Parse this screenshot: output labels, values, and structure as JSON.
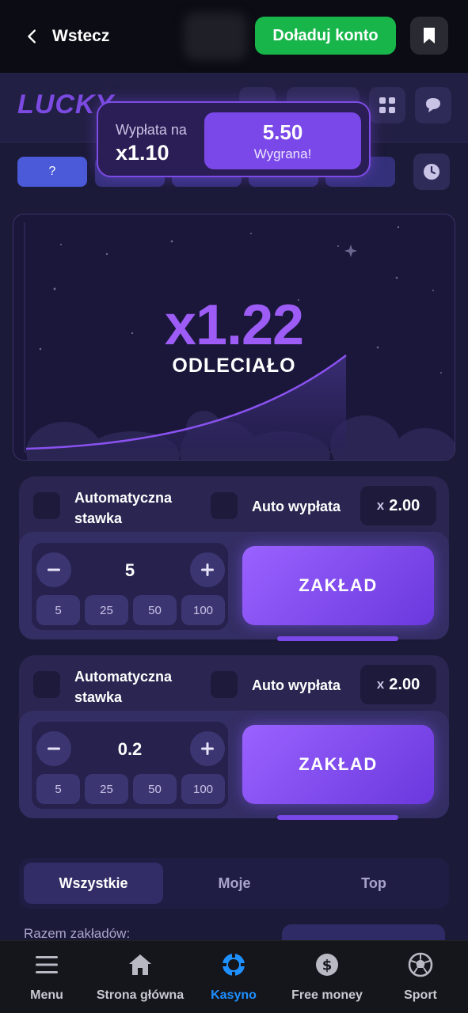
{
  "topbar": {
    "back_label": "Wstecz",
    "deposit_label": "Doładuj konto",
    "deposit_color": "#18b64a"
  },
  "game": {
    "logo_text": "LUCKY",
    "accent_color": "#7a48e8"
  },
  "toast": {
    "label": "Wypłata na",
    "multiplier": "x1.10",
    "amount": "5.50",
    "win_text": "Wygrana!"
  },
  "history": {
    "first_label": "?"
  },
  "round": {
    "multiplier": "x1.22",
    "status": "ODLECIAŁO"
  },
  "bet_panels": [
    {
      "auto_bet_label": "Automatyczna stawka",
      "auto_cashout_label": "Auto wypłata",
      "cashout_prefix": "x",
      "cashout_value": "2.00",
      "stake": "5",
      "chips": [
        "5",
        "25",
        "50",
        "100"
      ],
      "bet_button": "ZAKŁAD"
    },
    {
      "auto_bet_label": "Automatyczna stawka",
      "auto_cashout_label": "Auto wypłata",
      "cashout_prefix": "x",
      "cashout_value": "2.00",
      "stake": "0.2",
      "chips": [
        "5",
        "25",
        "50",
        "100"
      ],
      "bet_button": "ZAKŁAD"
    }
  ],
  "tabs": [
    "Wszystkie",
    "Moje",
    "Top"
  ],
  "active_tab": "Wszystkie",
  "bets_summary": {
    "total_label": "Razem zakładów:"
  },
  "bottom_nav": [
    {
      "label": "Menu",
      "icon": "menu-icon"
    },
    {
      "label": "Strona główna",
      "icon": "home-icon"
    },
    {
      "label": "Kasyno",
      "icon": "casino-chip-icon",
      "active": true
    },
    {
      "label": "Free money",
      "icon": "dollar-coin-icon"
    },
    {
      "label": "Sport",
      "icon": "soccer-ball-icon"
    }
  ],
  "bottom_nav_active_color": "#1e90ff"
}
